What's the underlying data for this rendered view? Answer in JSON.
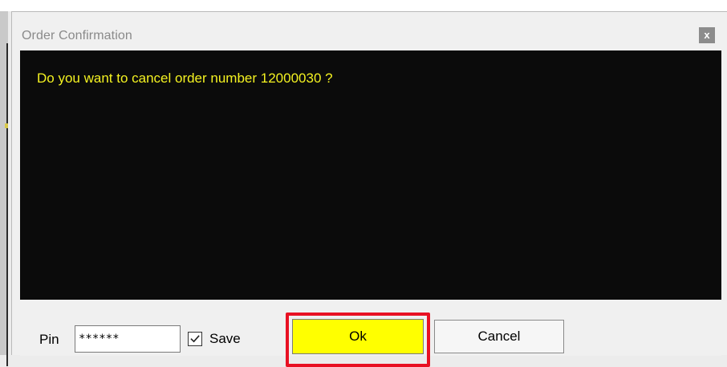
{
  "dialog": {
    "title": "Order Confirmation",
    "close_label": "x",
    "message": "Do you want to cancel order number 12000030 ?"
  },
  "form": {
    "pin_label": "Pin",
    "pin_value": "******",
    "save_label": "Save",
    "save_checked": true
  },
  "buttons": {
    "ok_label": "Ok",
    "cancel_label": "Cancel"
  },
  "colors": {
    "message_panel_bg": "#0b0b0b",
    "message_text": "#f4f221",
    "ok_button_bg": "#ffff00",
    "highlight_border": "#e81123",
    "close_button_bg": "#8c8c8c"
  },
  "icons": {
    "close": "close-icon",
    "checkbox": "checkmark-icon"
  }
}
